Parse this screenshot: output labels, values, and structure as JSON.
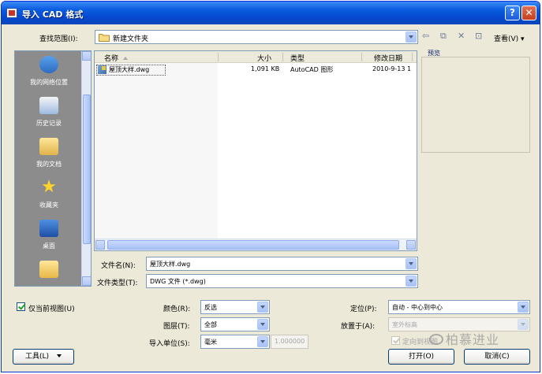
{
  "window": {
    "title": "导入 CAD 格式"
  },
  "lookin": {
    "label": "查找范围(I):",
    "value": "新建文件夹"
  },
  "toolbar": {
    "view_menu": "查看(V) ▾"
  },
  "places": [
    "我的网络位置",
    "历史记录",
    "我的文档",
    "收藏夹",
    "桌面"
  ],
  "filelist": {
    "headers": {
      "name": "名称",
      "size": "大小",
      "type": "类型",
      "modified": "修改日期"
    },
    "rows": [
      {
        "name": "屋顶大样.dwg",
        "size": "1,091 KB",
        "type": "AutoCAD 图形",
        "modified": "2010-9-13 1"
      }
    ]
  },
  "preview": {
    "label": "预览"
  },
  "filename": {
    "label": "文件名(N):",
    "value": "屋顶大样.dwg"
  },
  "filetype": {
    "label": "文件类型(T):",
    "value": "DWG 文件 (*.dwg)"
  },
  "options": {
    "current_view_only": "仅当前视图(U)",
    "color_label": "颜色(R):",
    "color_value": "反选",
    "layers_label": "图层(T):",
    "layers_value": "全部",
    "units_label": "导入单位(S):",
    "units_value": "毫米",
    "units_scale": "1.000000",
    "position_label": "定位(P):",
    "position_value": "自动 - 中心到中心",
    "place_label": "放置于(A):",
    "place_value": "室外标高",
    "orient_label": "定向到视图"
  },
  "buttons": {
    "tools": "工具(L)",
    "open": "打开(O)",
    "cancel": "取消(C)"
  },
  "watermark": "柏慕进业"
}
